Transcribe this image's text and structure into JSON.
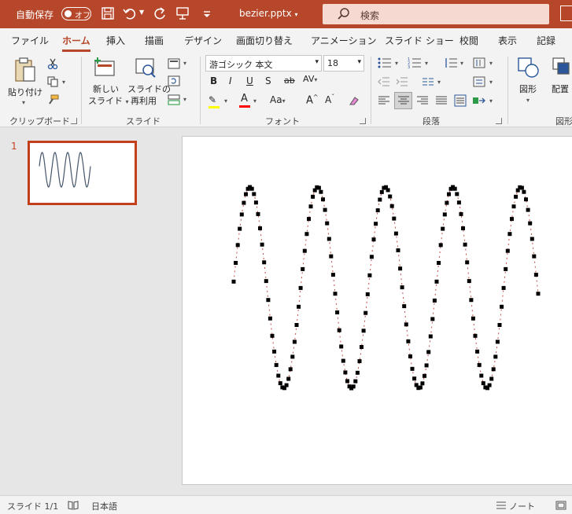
{
  "titlebar": {
    "autosave_label": "自動保存",
    "toggle_state": "オフ",
    "filename": "bezier.pptx",
    "search_placeholder": "検索"
  },
  "tabs": [
    "ファイル",
    "ホーム",
    "挿入",
    "描画",
    "デザイン",
    "画面切り替え",
    "アニメーション",
    "スライド ショー",
    "校閲",
    "表示",
    "記録"
  ],
  "active_tab": "ホーム",
  "ribbon": {
    "clipboard": {
      "paste": "貼り付け",
      "label": "クリップボード"
    },
    "slides": {
      "new_slide_1": "新しい",
      "new_slide_2": "スライド",
      "reuse_1": "スライドの",
      "reuse_2": "再利用",
      "label": "スライド"
    },
    "font": {
      "font_name": "游ゴシック 本文",
      "font_size": "18",
      "label": "フォント"
    },
    "paragraph": {
      "label": "段落"
    },
    "drawing": {
      "shapes": "図形",
      "arrange": "配置",
      "label": "図形"
    }
  },
  "thumbnails": [
    {
      "number": "1"
    }
  ],
  "status": {
    "slide_info": "スライド 1/1",
    "language": "日本語",
    "notes": "ノート"
  },
  "colors": {
    "accent": "#b7472a",
    "thumb_border": "#c43e1c",
    "thumb_wave": "#44546a",
    "font_color_bar": "#ff0000",
    "highlight_bar": "#ffff00"
  }
}
